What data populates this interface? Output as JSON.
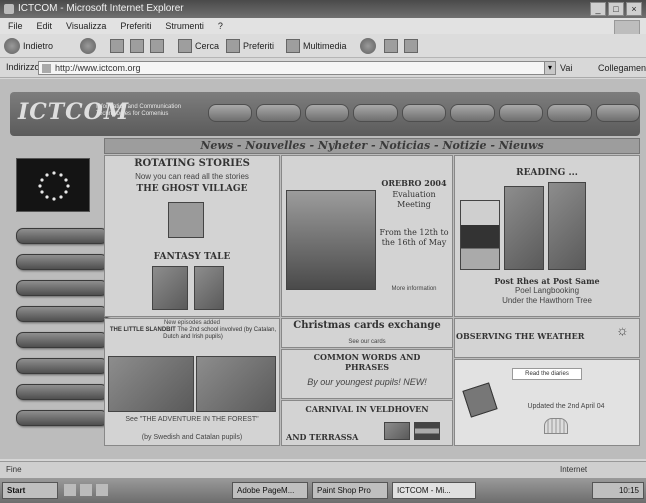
{
  "window": {
    "title": "ICTCOM - Microsoft Internet Explorer",
    "btn_min": "_",
    "btn_max": "□",
    "btn_close": "×"
  },
  "menu": [
    "File",
    "Edit",
    "Visualizza",
    "Preferiti",
    "Strumenti",
    "?"
  ],
  "toolbar": {
    "back": "Indietro",
    "search": "Cerca",
    "favorites": "Preferiti",
    "multimedia": "Multimedia"
  },
  "address": {
    "label": "Indirizzo",
    "url": "http://www.ictcom.org",
    "go": "Vai",
    "links": "Collegamenti"
  },
  "site": {
    "logo": "ICTCOM",
    "tagline": "Information and Communication Technologies for Comenius"
  },
  "newsbar": "News - Nouvelles - Nyheter - Noticias - Notizie - Nieuws",
  "col1": {
    "heading": "ROTATING STORIES",
    "subtitle": "Now you can read all the stories",
    "story": "THE GHOST VILLAGE",
    "fantasy": "FANTASY TALE",
    "slh_note": "New episodes added",
    "slh_title": "THE LITTLE SLANDBIT",
    "slh_note2": "The 2nd school involved (by Catalan, Dutch and Irish pupils)",
    "adv_title": "See \"THE ADVENTURE IN THE FOREST\"",
    "adv_note": "(by Swedish and Catalan pupils)"
  },
  "col2": {
    "mtg_title": "OREBRO 2004",
    "mtg_sub": "Evaluation Meeting",
    "mtg_date": "From the 12th to the 16th of May",
    "mtg_more": "More information",
    "xmas_title": "Christmas cards exchange",
    "xmas_link": "See our cards",
    "common_title": "COMMON WORDS AND PHRASES",
    "common_note": "By our youngest pupils! NEW!",
    "carnival_title": "CARNIVAL IN VELDHOVEN",
    "carnival_and": "AND TERRASSA"
  },
  "col3": {
    "reading_title": "READING ...",
    "reading_caption": "Post Rhes at Post Same",
    "reading_line2": "Poel Langbooking",
    "reading_line3": "Under the Hawthorn Tree",
    "weather_title": "OBSERVING THE WEATHER",
    "weather_link": "Read the diaries",
    "weather_updated": "Updated the 2nd April 04"
  },
  "status": {
    "left": "Fine",
    "right": "Internet"
  },
  "taskbar": {
    "start": "Start",
    "tasks": [
      "Adobe PageM...",
      "Paint Shop Pro",
      "ICTCOM - Mi..."
    ],
    "clock": "10:15"
  },
  "colors": {
    "page_bg": "#bcbcbc",
    "header": "#6b6b6b",
    "cell": "#d3d3d3"
  }
}
